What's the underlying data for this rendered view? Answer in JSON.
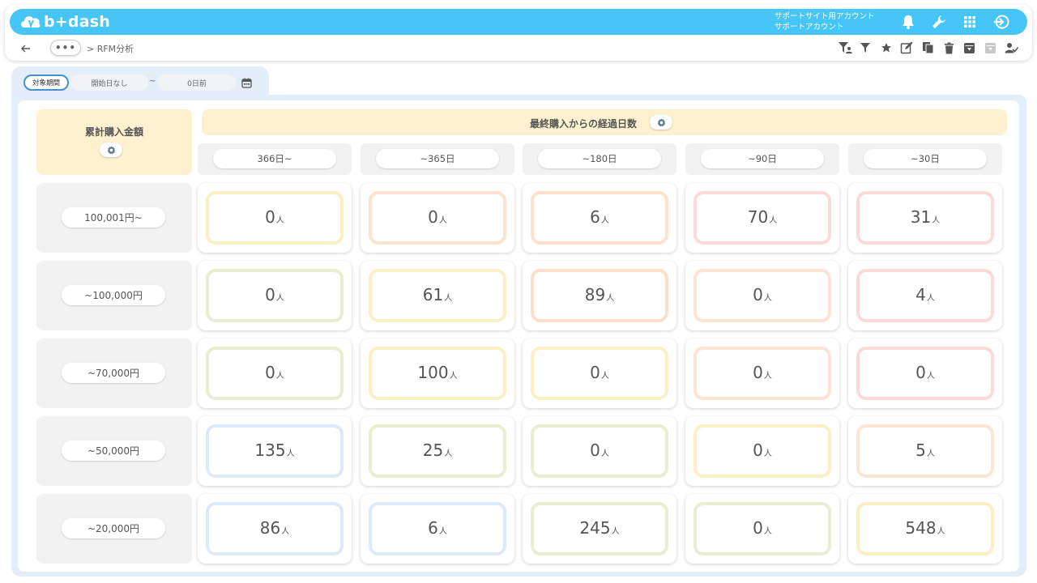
{
  "app": {
    "logo_text": "b+dash",
    "account_line1": "サポートサイト用アカウント",
    "account_line2": "サポートアカウント"
  },
  "nav": {
    "breadcrumb_dots": "•••",
    "breadcrumb": "> RFM分析"
  },
  "filter": {
    "period_label": "対象期間",
    "start_value": "開始日なし",
    "separator": "~",
    "end_value": "0日前"
  },
  "matrix": {
    "y_title": "累計購入金額",
    "x_title": "最終購入からの経過日数",
    "unit": "人",
    "columns": [
      "366日~",
      "~365日",
      "~180日",
      "~90日",
      "~30日"
    ],
    "rows": [
      {
        "label": "100,001円~",
        "values": [
          "0",
          "0",
          "6",
          "70",
          "31"
        ]
      },
      {
        "label": "~100,000円",
        "values": [
          "0",
          "61",
          "89",
          "0",
          "4"
        ]
      },
      {
        "label": "~70,000円",
        "values": [
          "0",
          "100",
          "0",
          "0",
          "0"
        ]
      },
      {
        "label": "~50,000円",
        "values": [
          "135",
          "25",
          "0",
          "0",
          "5"
        ]
      },
      {
        "label": "~20,000円",
        "values": [
          "86",
          "6",
          "245",
          "0",
          "548"
        ]
      }
    ]
  },
  "colors": {
    "topbar": "#45c6f6",
    "cell_borders": [
      [
        "#fdefc4",
        "#fde3cf",
        "#fde1cc",
        "#fddada",
        "#fddada"
      ],
      [
        "#e9edd2",
        "#fdf0c6",
        "#fde0cc",
        "#fde4d4",
        "#fddada"
      ],
      [
        "#e9edd2",
        "#fdefc4",
        "#fdf0c6",
        "#fde4d4",
        "#fddada"
      ],
      [
        "#dceaf8",
        "#e9edd2",
        "#e9edd2",
        "#fdf0c6",
        "#fde4d4"
      ],
      [
        "#dceaf8",
        "#dceaf8",
        "#e9edd2",
        "#e9edd2",
        "#fdefc4"
      ]
    ]
  },
  "icons": {
    "top": [
      "bell-icon",
      "wrench-icon",
      "apps-grid-icon",
      "logout-icon"
    ],
    "toolbar": [
      "filter-user-icon",
      "filter-icon",
      "star-icon",
      "edit-icon",
      "copy-icon",
      "trash-icon",
      "download-box-icon",
      "download-box-disabled-icon",
      "user-check-icon"
    ]
  }
}
